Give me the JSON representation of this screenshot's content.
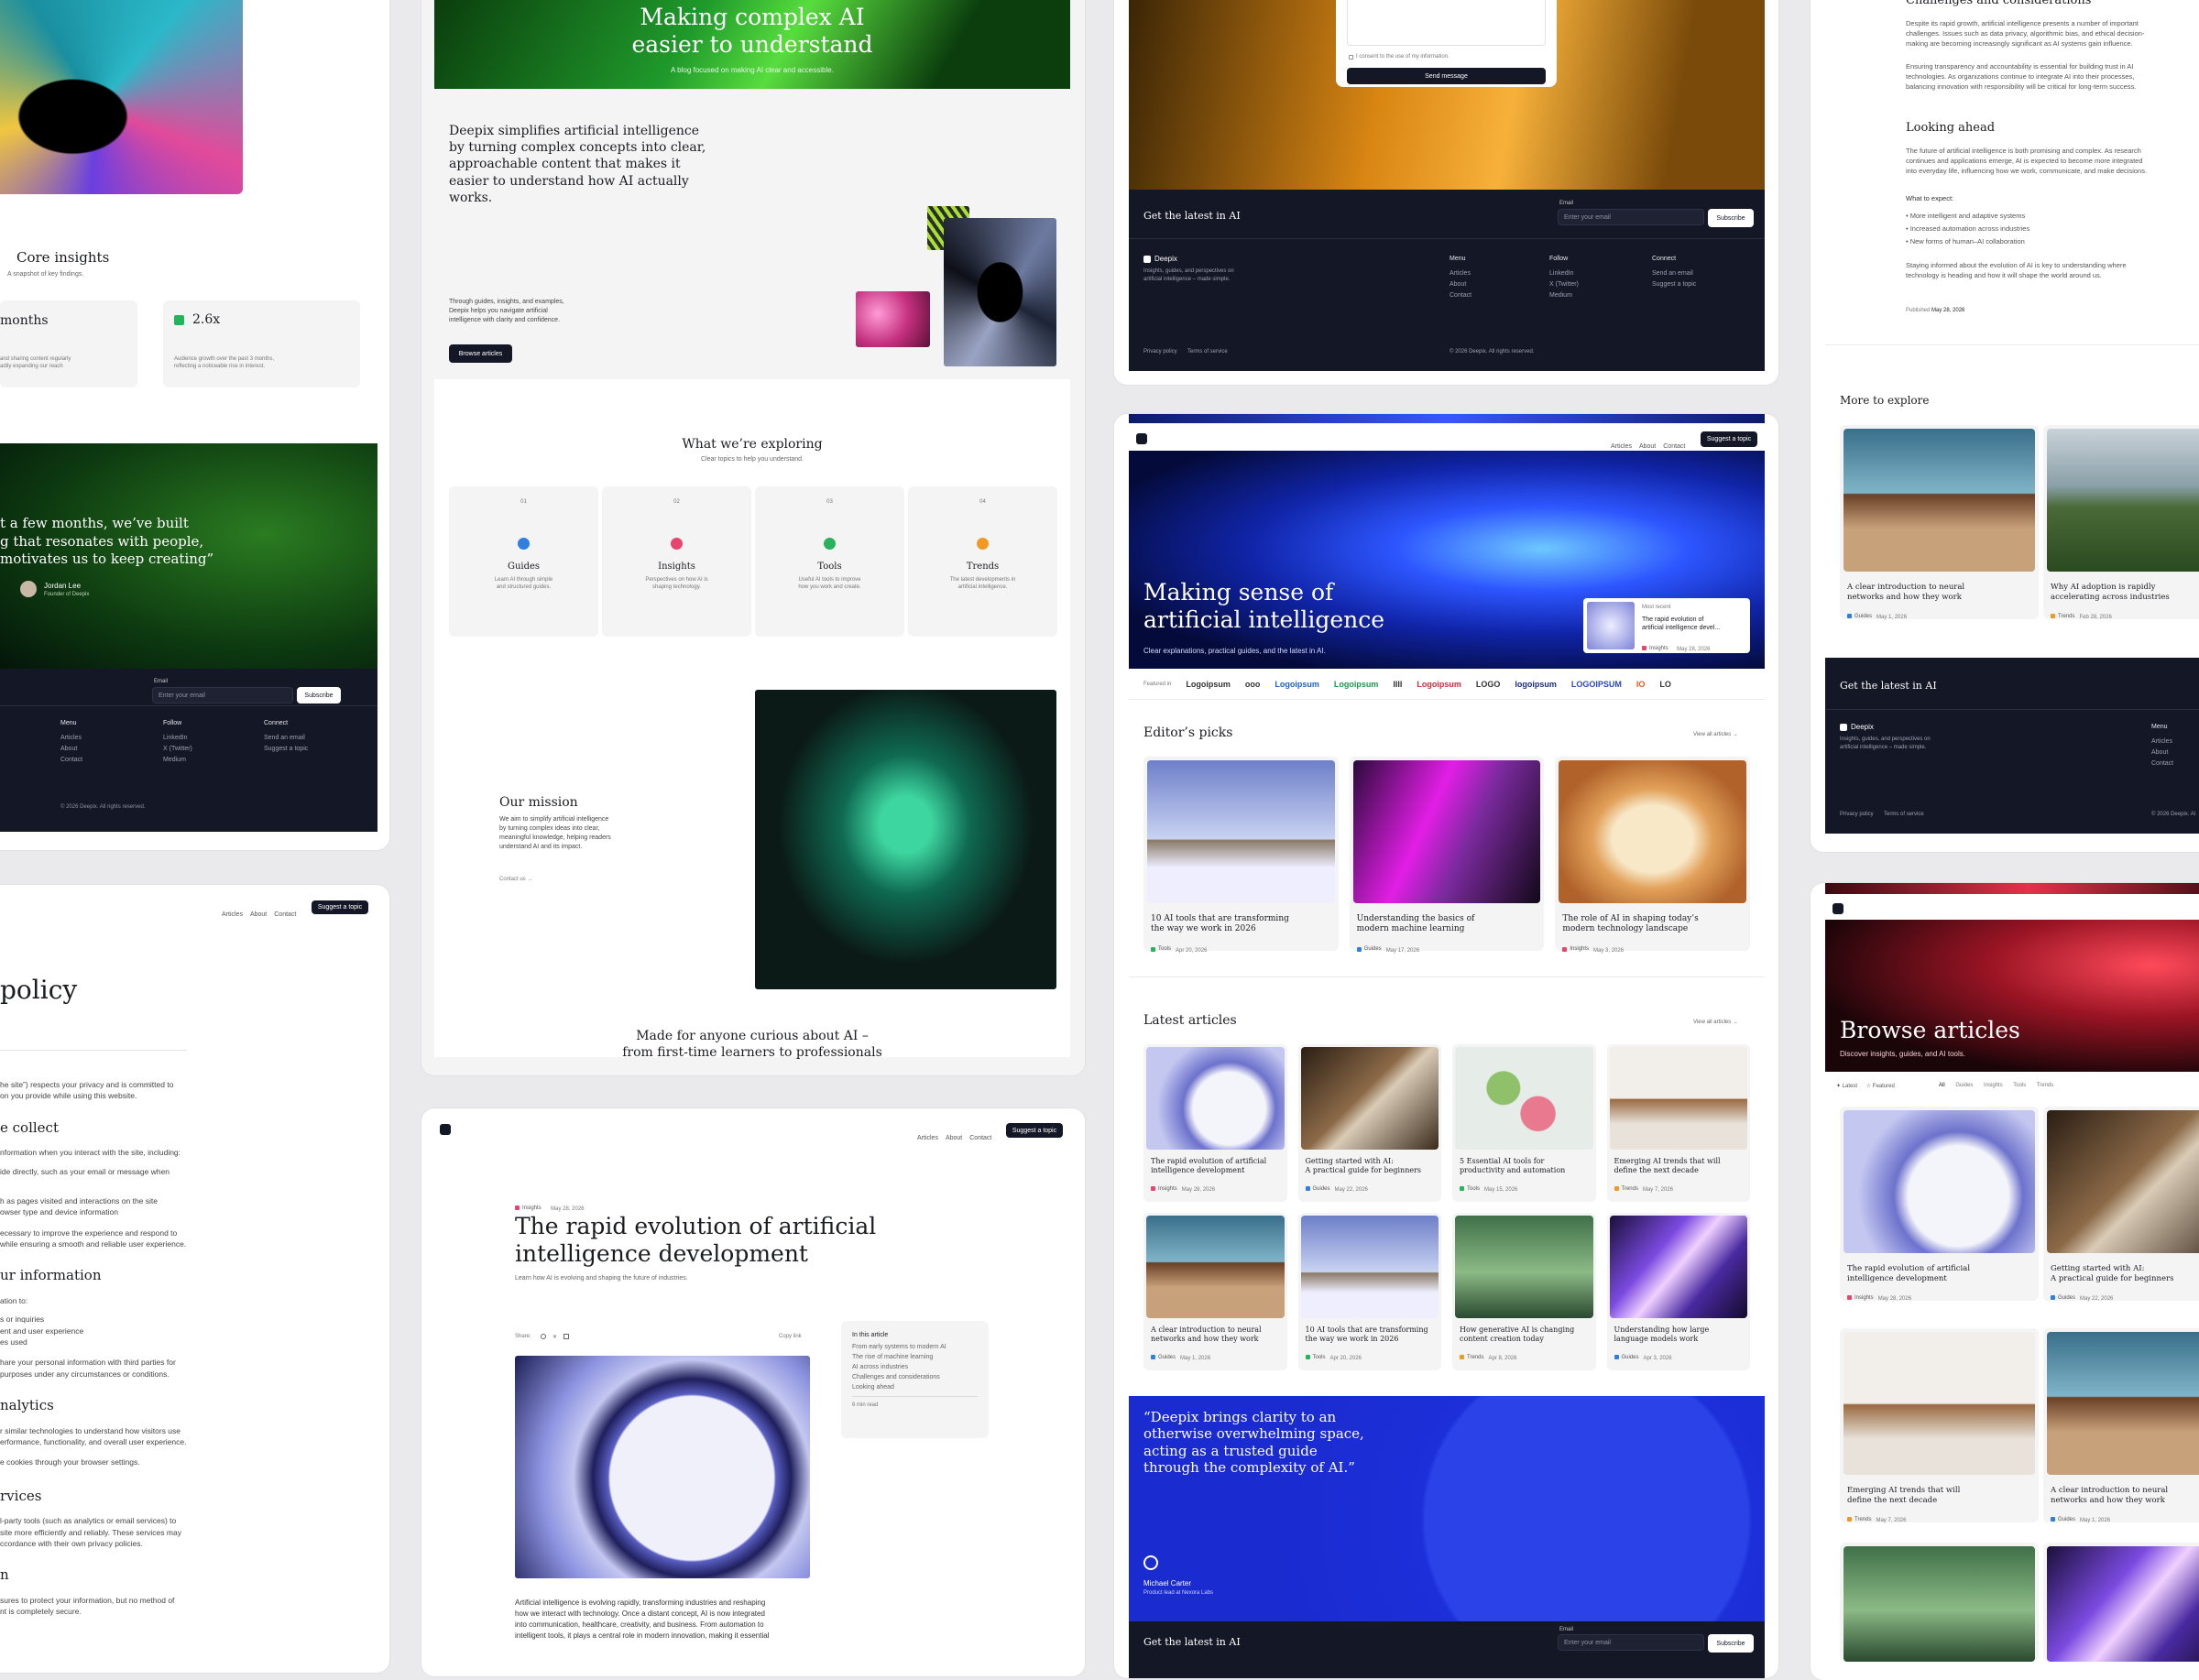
{
  "col1": {
    "core_title": "Core insights",
    "core_sub": "A snapshot of key findings.",
    "stat1_value": "months",
    "stat1_desc": "and sharing content regularly\nadily expanding our reach",
    "stat2_value": "2.6x",
    "stat2_desc": "Audience growth over the past 3 months,\nreflecting a noticeable rise in interest.",
    "quote": "t a few months, we’ve built\ng that resonates with people,\nmotivates us to keep creating”",
    "author_name": "Jordan Lee",
    "author_role": "Founder of Deepix",
    "email_label": "Email",
    "email_placeholder": "Enter your email",
    "subscribe": "Subscribe",
    "footer_menu": "Menu",
    "footer_menu_items": [
      "Articles",
      "About",
      "Contact"
    ],
    "footer_follow": "Follow",
    "footer_follow_items": [
      "LinkedIn",
      "X (Twitter)",
      "Medium"
    ],
    "footer_connect": "Connect",
    "footer_connect_items": [
      "Send an email",
      "Suggest a topic"
    ],
    "copyright": "© 2026 Deepix. All rights reserved."
  },
  "policy": {
    "nav": [
      "Articles",
      "About",
      "Contact"
    ],
    "cta": "Suggest a topic",
    "title": "policy",
    "p1": "he site”) respects your privacy and is committed to\non you provide while using this website.",
    "h1": "e collect",
    "p2": "nformation when you interact with the site, including:",
    "p3": "ide directly, such as your email or message when",
    "p4": "h as pages visited and interactions on the site\nowser type and device information",
    "p5": "ecessary to improve the experience and respond to\n while ensuring a smooth and reliable user experience.",
    "h2": "ur information",
    "p6": "ation to:",
    "p7": "s or inquiries\nent and user experience\nes used",
    "p8": "hare your personal information with third parties for\n purposes under any circumstances or conditions.",
    "h3": "nalytics",
    "p9": "r similar technologies to understand how visitors use\nerformance, functionality, and overall user experience.",
    "p10": "e cookies through your browser settings.",
    "h4": "rvices",
    "p11": "l-party tools (such as analytics or email services) to\n site more efficiently and reliably. These services may\nccordance with their own privacy policies.",
    "h5": "n",
    "p12": "sures to protect your information, but no method of\nnt is completely secure."
  },
  "about": {
    "hero_title": "Making complex AI\neasier to understand",
    "hero_sub": "A blog focused on making AI clear and accessible.",
    "intro": "Deepix simplifies artificial intelligence by turning complex concepts into clear, approachable content that makes it easier to understand how AI actually works.",
    "intro_small": "Through guides, insights, and examples,\nDeepix helps you navigate artificial\nintelligence with clarity and confidence.",
    "browse": "Browse articles",
    "explore_title": "What we’re exploring",
    "explore_sub": "Clear topics to help you understand.",
    "topics": [
      {
        "num": "01",
        "name": "Guides",
        "desc": "Learn AI through simple\nand structured guides.",
        "color": "#2f7fe0"
      },
      {
        "num": "02",
        "name": "Insights",
        "desc": "Perspectives on how AI is\nshaping technology.",
        "color": "#e8456c"
      },
      {
        "num": "03",
        "name": "Tools",
        "desc": "Useful AI tools to improve\nhow you work and create.",
        "color": "#27b35b"
      },
      {
        "num": "04",
        "name": "Trends",
        "desc": "The latest developments in\nartificial intelligence.",
        "color": "#f09a24"
      }
    ],
    "mission_title": "Our mission",
    "mission_text": "We aim to simplify artificial intelligence\nby turning complex ideas into clear,\nmeaningful knowledge, helping readers\nunderstand AI and its impact.",
    "contact_link": "Contact us →",
    "made_for": "Made for anyone curious about AI –\nfrom first-time learners to professionals"
  },
  "article": {
    "nav": [
      "Articles",
      "About",
      "Contact"
    ],
    "cta": "Suggest a topic",
    "tag": "Insights",
    "date": "May 28, 2026",
    "title": "The rapid evolution of artificial\nintelligence development",
    "sub": "Learn how AI is evolving and shaping the future of industries.",
    "share": "Share:",
    "copy_link": "Copy link",
    "toc_title": "In this article",
    "toc": [
      "From early systems to modern AI",
      "The rise of machine learning",
      "AI across industries",
      "Challenges and considerations",
      "Looking ahead"
    ],
    "read_time": "6 min read",
    "body": "Artificial intelligence is evolving rapidly, transforming industries and reshaping\nhow we interact with technology. Once a distant concept, AI is now integrated\ninto communication, healthcare, creativity, and business. From automation to\nintelligent tools, it plays a central role in modern innovation, making it essential"
  },
  "contact": {
    "consent": "I consent to the use of my information.",
    "send": "Send message",
    "latest": "Get the latest in AI",
    "email_label": "Email",
    "email_placeholder": "Enter your email",
    "subscribe": "Subscribe",
    "brand": "Deepix",
    "brand_desc": "Insights, guides, and perspectives on\nartificial intelligence – made simple.",
    "menu": "Menu",
    "menu_items": [
      "Articles",
      "About",
      "Contact"
    ],
    "follow": "Follow",
    "follow_items": [
      "LinkedIn",
      "X (Twitter)",
      "Medium"
    ],
    "connect": "Connect",
    "connect_items": [
      "Send an email",
      "Suggest a topic"
    ],
    "privacy": "Privacy policy",
    "terms": "Terms of service",
    "copyright": "© 2026 Deepix. All rights reserved."
  },
  "home": {
    "nav": [
      "Articles",
      "About",
      "Contact"
    ],
    "cta": "Suggest a topic",
    "hero_title": "Making sense of\nartificial intelligence",
    "hero_sub": "Clear explanations, practical guides, and the latest in AI.",
    "most_recent": "Most recent",
    "recent_title": "The rapid evolution of\nartificial intelligence devel...",
    "recent_tag": "Insights",
    "recent_date": "May 28, 2026",
    "featured_in": "Featured in",
    "logos": [
      "Logoipsum",
      "ooo",
      "Logoipsum",
      "Logoipsum",
      "IIII",
      "Logoipsum",
      "LOGO",
      "logoipsum",
      "LOGOIPSUM",
      "IO",
      "LO"
    ],
    "editors_title": "Editor’s picks",
    "view_all": "View all articles →",
    "editors": [
      {
        "title": "10 AI tools that are transforming\nthe way we work in 2026",
        "tag": "Tools",
        "date": "Apr 20, 2026",
        "color": "#27b35b"
      },
      {
        "title": "Understanding the basics of\nmodern machine learning",
        "tag": "Guides",
        "date": "May 17, 2026",
        "color": "#2f7fe0"
      },
      {
        "title": "The role of AI in shaping today’s\nmodern technology landscape",
        "tag": "Insights",
        "date": "May 3, 2026",
        "color": "#e8456c"
      }
    ],
    "latest_title": "Latest articles",
    "latest": [
      {
        "title": "The rapid evolution of artificial\nintelligence development",
        "tag": "Insights",
        "date": "May 28, 2026",
        "color": "#e8456c"
      },
      {
        "title": "Getting started with AI:\nA practical guide for beginners",
        "tag": "Guides",
        "date": "May 22, 2026",
        "color": "#2f7fe0"
      },
      {
        "title": "5 Essential AI tools for\nproductivity and automation",
        "tag": "Tools",
        "date": "May 15, 2026",
        "color": "#27b35b"
      },
      {
        "title": "Emerging AI trends that will\ndefine the next decade",
        "tag": "Trends",
        "date": "May 7, 2026",
        "color": "#f09a24"
      },
      {
        "title": "A clear introduction to neural\nnetworks and how they work",
        "tag": "Guides",
        "date": "May 1, 2026",
        "color": "#2f7fe0"
      },
      {
        "title": "10 AI tools that are transforming\nthe way we work in 2026",
        "tag": "Tools",
        "date": "Apr 20, 2026",
        "color": "#27b35b"
      },
      {
        "title": "How generative AI is changing\ncontent creation today",
        "tag": "Trends",
        "date": "Apr 8, 2026",
        "color": "#f09a24"
      },
      {
        "title": "Understanding how large\nlanguage models work",
        "tag": "Guides",
        "date": "Apr 3, 2026",
        "color": "#2f7fe0"
      }
    ],
    "testimonial": "“Deepix brings clarity to an\notherwise overwhelming space,\nacting as a trusted guide\nthrough the complexity of AI.”",
    "t_name": "Michael Carter",
    "t_role": "Product lead at Nexora Labs",
    "latest_ai": "Get the latest in AI",
    "email_label": "Email",
    "email_placeholder": "Enter your email",
    "subscribe": "Subscribe"
  },
  "post": {
    "challenges_title": "Challenges and considerations",
    "c_p1": "Despite its rapid growth, artificial intelligence presents a number of important\nchallenges. Issues such as data privacy, algorithmic bias, and ethical decision-\nmaking are becoming increasingly significant as AI systems gain influence.",
    "c_p2": "Ensuring transparency and accountability is essential for building trust in AI\ntechnologies. As organizations continue to integrate AI into their processes,\nbalancing innovation with responsibility will be critical for long-term success.",
    "ahead_title": "Looking ahead",
    "a_p1": "The future of artificial intelligence is both promising and complex. As research\ncontinues and applications emerge, AI is expected to become more integrated\ninto everyday life, influencing how we work, communicate, and make decisions.",
    "expect": "What to expect:",
    "bullets": [
      "More intelligent and adaptive systems",
      "Increased automation across industries",
      "New forms of human–AI collaboration"
    ],
    "a_p2": "Staying informed about the evolution of AI is key to understanding where\ntechnology is heading and how it will shape the world around us.",
    "published_label": "Published",
    "published": "May 28, 2026",
    "more_title": "More to explore",
    "more": [
      {
        "title": "A clear introduction to neural\nnetworks and how they work",
        "tag": "Guides",
        "date": "May 1, 2026",
        "color": "#2f7fe0"
      },
      {
        "title": "Why AI adoption is rapidly\naccelerating across industries",
        "tag": "Trends",
        "date": "Feb 28, 2026",
        "color": "#f09a24"
      }
    ],
    "latest_ai": "Get the latest in AI",
    "brand": "Deepix",
    "brand_desc": "Insights, guides, and perspectives on\nartificial intelligence – made simple.",
    "menu": "Menu",
    "menu_items": [
      "Articles",
      "About",
      "Contact"
    ],
    "privacy": "Privacy policy",
    "terms": "Terms of service",
    "copyright": "© 2026 Deepix. Al"
  },
  "browse": {
    "title": "Browse articles",
    "sub": "Discover insights, guides, and AI tools.",
    "sort": [
      "Latest",
      "Featured"
    ],
    "filters": [
      "All",
      "Guides",
      "Insights",
      "Tools",
      "Trends"
    ],
    "items": [
      {
        "title": "The rapid evolution of artificial\nintelligence development",
        "tag": "Insights",
        "date": "May 28, 2026",
        "color": "#e8456c"
      },
      {
        "title": "Getting started with AI:\nA practical guide for beginners",
        "tag": "Guides",
        "date": "May 22, 2026",
        "color": "#2f7fe0"
      },
      {
        "title": "Emerging AI trends that will\ndefine the next decade",
        "tag": "Trends",
        "date": "May 7, 2026",
        "color": "#f09a24"
      },
      {
        "title": "A clear introduction to neural\nnetworks and how they work",
        "tag": "Guides",
        "date": "May 1, 2026",
        "color": "#2f7fe0"
      }
    ]
  }
}
